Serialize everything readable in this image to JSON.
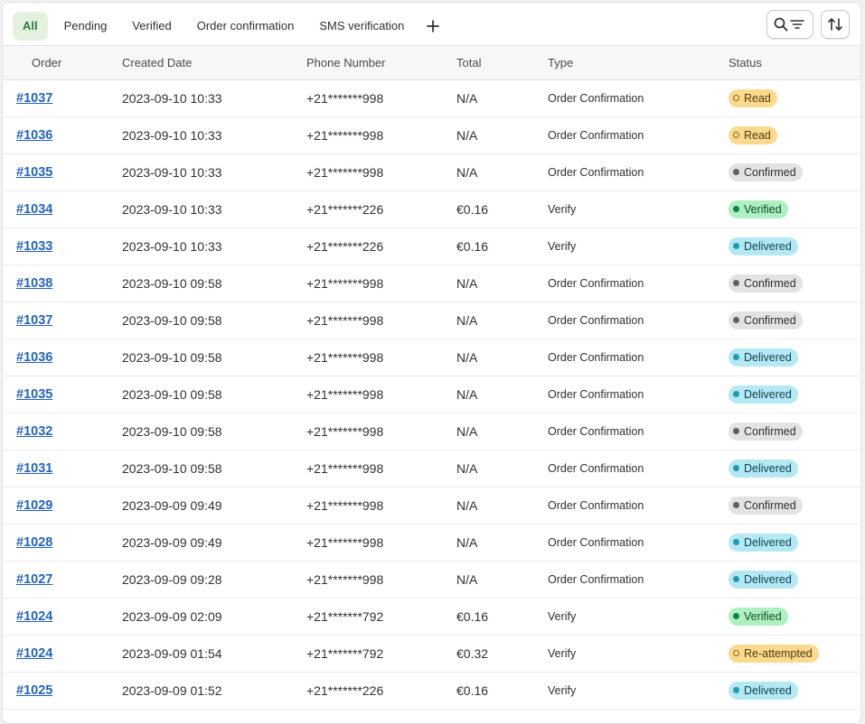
{
  "tabs": [
    {
      "label": "All",
      "active": true
    },
    {
      "label": "Pending",
      "active": false
    },
    {
      "label": "Verified",
      "active": false
    },
    {
      "label": "Order confirmation",
      "active": false
    },
    {
      "label": "SMS verification",
      "active": false
    }
  ],
  "icons": {
    "add_tab": "plus-icon",
    "search_filter": "search-filter-icon",
    "sort": "sort-icon"
  },
  "table": {
    "columns": [
      "Order",
      "Created Date",
      "Phone Number",
      "Total",
      "Type",
      "Status"
    ],
    "rows": [
      {
        "order": "#1037",
        "date": "2023-09-10 10:33",
        "phone": "+21*******998",
        "total": "N/A",
        "type": "Order Confirmation",
        "status": "Read",
        "status_kind": "read"
      },
      {
        "order": "#1036",
        "date": "2023-09-10 10:33",
        "phone": "+21*******998",
        "total": "N/A",
        "type": "Order Confirmation",
        "status": "Read",
        "status_kind": "read"
      },
      {
        "order": "#1035",
        "date": "2023-09-10 10:33",
        "phone": "+21*******998",
        "total": "N/A",
        "type": "Order Confirmation",
        "status": "Confirmed",
        "status_kind": "confirmed"
      },
      {
        "order": "#1034",
        "date": "2023-09-10 10:33",
        "phone": "+21*******226",
        "total": "€0.16",
        "type": "Verify",
        "status": "Verified",
        "status_kind": "verified"
      },
      {
        "order": "#1033",
        "date": "2023-09-10 10:33",
        "phone": "+21*******226",
        "total": "€0.16",
        "type": "Verify",
        "status": "Delivered",
        "status_kind": "delivered"
      },
      {
        "order": "#1038",
        "date": "2023-09-10 09:58",
        "phone": "+21*******998",
        "total": "N/A",
        "type": "Order Confirmation",
        "status": "Confirmed",
        "status_kind": "confirmed"
      },
      {
        "order": "#1037",
        "date": "2023-09-10 09:58",
        "phone": "+21*******998",
        "total": "N/A",
        "type": "Order Confirmation",
        "status": "Confirmed",
        "status_kind": "confirmed"
      },
      {
        "order": "#1036",
        "date": "2023-09-10 09:58",
        "phone": "+21*******998",
        "total": "N/A",
        "type": "Order Confirmation",
        "status": "Delivered",
        "status_kind": "delivered"
      },
      {
        "order": "#1035",
        "date": "2023-09-10 09:58",
        "phone": "+21*******998",
        "total": "N/A",
        "type": "Order Confirmation",
        "status": "Delivered",
        "status_kind": "delivered"
      },
      {
        "order": "#1032",
        "date": "2023-09-10 09:58",
        "phone": "+21*******998",
        "total": "N/A",
        "type": "Order Confirmation",
        "status": "Confirmed",
        "status_kind": "confirmed"
      },
      {
        "order": "#1031",
        "date": "2023-09-10 09:58",
        "phone": "+21*******998",
        "total": "N/A",
        "type": "Order Confirmation",
        "status": "Delivered",
        "status_kind": "delivered"
      },
      {
        "order": "#1029",
        "date": "2023-09-09 09:49",
        "phone": "+21*******998",
        "total": "N/A",
        "type": "Order Confirmation",
        "status": "Confirmed",
        "status_kind": "confirmed"
      },
      {
        "order": "#1028",
        "date": "2023-09-09 09:49",
        "phone": "+21*******998",
        "total": "N/A",
        "type": "Order Confirmation",
        "status": "Delivered",
        "status_kind": "delivered"
      },
      {
        "order": "#1027",
        "date": "2023-09-09 09:28",
        "phone": "+21*******998",
        "total": "N/A",
        "type": "Order Confirmation",
        "status": "Delivered",
        "status_kind": "delivered"
      },
      {
        "order": "#1024",
        "date": "2023-09-09 02:09",
        "phone": "+21*******792",
        "total": "€0.16",
        "type": "Verify",
        "status": "Verified",
        "status_kind": "verified"
      },
      {
        "order": "#1024",
        "date": "2023-09-09 01:54",
        "phone": "+21*******792",
        "total": "€0.32",
        "type": "Verify",
        "status": "Re-attempted",
        "status_kind": "reattempted"
      },
      {
        "order": "#1025",
        "date": "2023-09-09 01:52",
        "phone": "+21*******226",
        "total": "€0.16",
        "type": "Verify",
        "status": "Delivered",
        "status_kind": "delivered"
      }
    ]
  },
  "colors": {
    "active_tab_bg": "#e3f1df",
    "link": "#2463bc",
    "badge_read": "#fbd98d",
    "badge_confirmed": "#e3e3e3",
    "badge_verified": "#aef0c2",
    "badge_delivered": "#b4e8f2"
  }
}
